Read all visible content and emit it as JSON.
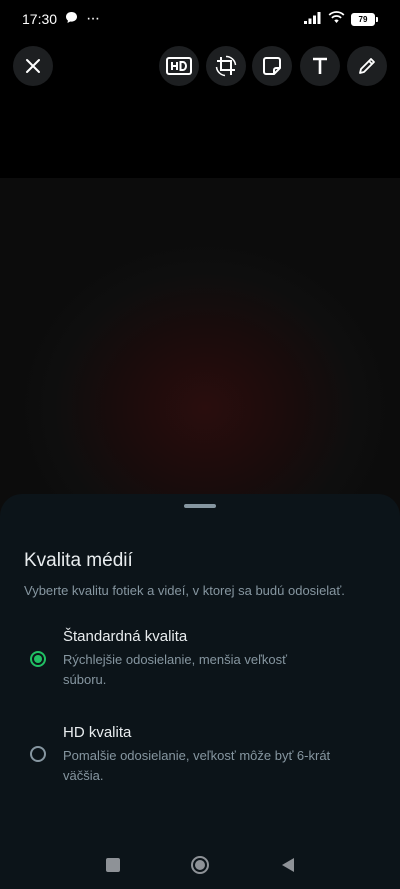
{
  "status_bar": {
    "time": "17:30",
    "dots": "···",
    "battery": "79"
  },
  "sheet": {
    "title": "Kvalita médií",
    "subtitle": "Vyberte kvalitu fotiek a videí, v ktorej sa budú odosielať.",
    "options": [
      {
        "label": "Štandardná kvalita",
        "description": "Rýchlejšie odosielanie, menšia veľkosť súboru.",
        "selected": true
      },
      {
        "label": "HD kvalita",
        "description": "Pomalšie odosielanie, veľkosť môže byť 6-krát väčšia.",
        "selected": false
      }
    ]
  },
  "colors": {
    "accent": "#21c063",
    "sheet_bg": "#0c1419",
    "secondary_text": "#8696a0"
  },
  "icons": {
    "toolbar": [
      "close-icon",
      "hd-icon",
      "crop-rotate-icon",
      "sticker-icon",
      "text-icon",
      "pencil-icon"
    ],
    "nav": [
      "recents-square-icon",
      "home-circle-icon",
      "back-triangle-icon"
    ]
  }
}
